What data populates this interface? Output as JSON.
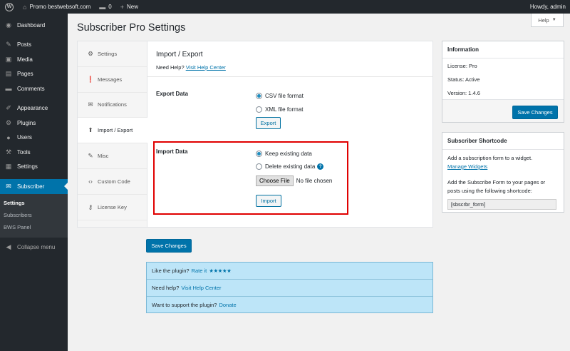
{
  "adminbar": {
    "site_name": "Promo bestwebsoft.com",
    "comments_count": "0",
    "new_label": "New",
    "greeting": "Howdy, admin"
  },
  "sidebar": {
    "items": [
      {
        "label": "Dashboard",
        "icon": "dashboard-icon",
        "glyph": "◉"
      },
      {
        "label": "Posts",
        "icon": "pin-icon",
        "glyph": "✎"
      },
      {
        "label": "Media",
        "icon": "media-icon",
        "glyph": "▣"
      },
      {
        "label": "Pages",
        "icon": "page-icon",
        "glyph": "▤"
      },
      {
        "label": "Comments",
        "icon": "comment-icon",
        "glyph": "▬"
      },
      {
        "label": "Appearance",
        "icon": "brush-icon",
        "glyph": "✐"
      },
      {
        "label": "Plugins",
        "icon": "plugin-icon",
        "glyph": "⚙"
      },
      {
        "label": "Users",
        "icon": "users-icon",
        "glyph": "●"
      },
      {
        "label": "Tools",
        "icon": "wrench-icon",
        "glyph": "⚒"
      },
      {
        "label": "Settings",
        "icon": "settings-icon",
        "glyph": "▦"
      },
      {
        "label": "Subscriber",
        "icon": "envelope-icon",
        "glyph": "✉"
      }
    ],
    "submenu": [
      "Settings",
      "Subscribers",
      "BWS Panel"
    ],
    "collapse_label": "Collapse menu"
  },
  "page": {
    "title": "Subscriber Pro Settings",
    "help_tab": "Help"
  },
  "tabs": [
    {
      "label": "Settings",
      "icon": "gear-icon",
      "glyph": "⚙"
    },
    {
      "label": "Messages",
      "icon": "alert-icon",
      "glyph": "❗"
    },
    {
      "label": "Notifications",
      "icon": "envelope-icon",
      "glyph": "✉"
    },
    {
      "label": "Import / Export",
      "icon": "upload-icon",
      "glyph": "⬆"
    },
    {
      "label": "Misc",
      "icon": "wrench-icon",
      "glyph": "✎"
    },
    {
      "label": "Custom Code",
      "icon": "code-icon",
      "glyph": "‹›"
    },
    {
      "label": "License Key",
      "icon": "key-icon",
      "glyph": "⚷"
    }
  ],
  "content": {
    "heading": "Import / Export",
    "need_help": "Need Help?",
    "help_link": "Visit Help Center",
    "export": {
      "label": "Export Data",
      "option_csv": "CSV file format",
      "option_xml": "XML file format",
      "button": "Export"
    },
    "import": {
      "label": "Import Data",
      "option_keep": "Keep existing data",
      "option_delete": "Delete existing data",
      "choose_file": "Choose File",
      "no_file": "No file chosen",
      "button": "Import"
    }
  },
  "save_changes": "Save Changes",
  "promo": {
    "like_text": "Like the plugin?",
    "rate_link": "Rate it",
    "stars": "★★★★★",
    "help_text": "Need help?",
    "help_link": "Visit Help Center",
    "support_text": "Want to support the plugin?",
    "donate_link": "Donate"
  },
  "info_box": {
    "title": "Information",
    "license": "License: Pro",
    "status": "Status: Active",
    "version": "Version: 1.4.6",
    "button": "Save Changes"
  },
  "shortcode_box": {
    "title": "Subscriber Shortcode",
    "widget_text": "Add a subscription form to a widget.",
    "widget_link": "Manage Widgets",
    "pages_text_1": "Add the Subscribe Form to your pages or",
    "pages_text_2": "posts using the following shortcode:",
    "shortcode": "[sbscrbr_form]"
  },
  "colors": {
    "accent": "#0073aa",
    "highlight_border": "#e00000",
    "promo_bg": "#bde5f8"
  }
}
